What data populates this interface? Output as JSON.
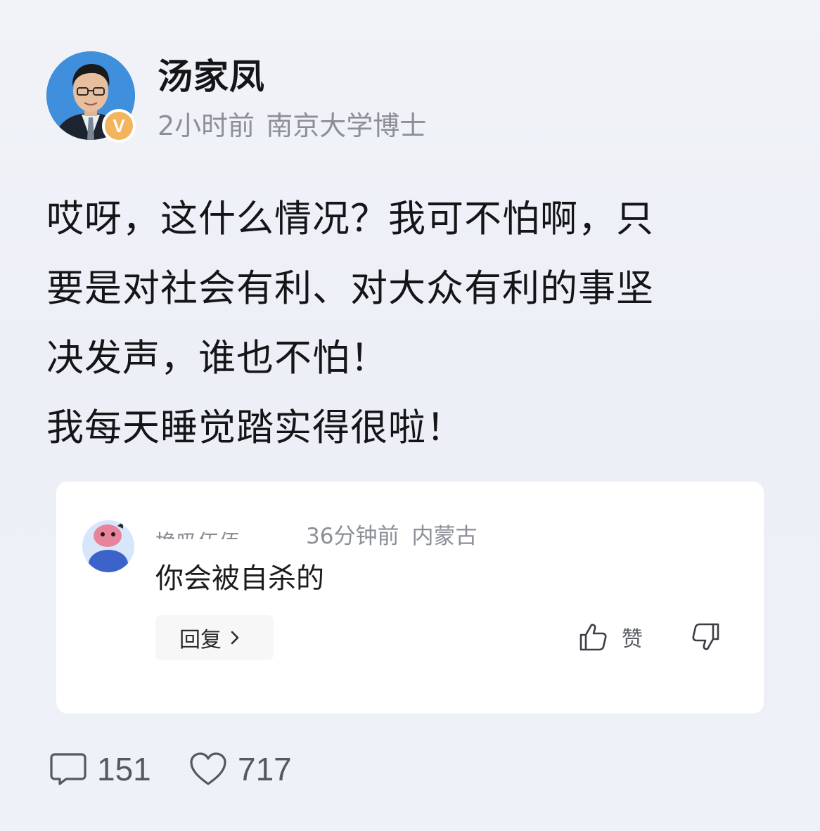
{
  "author": {
    "name": "汤家凤",
    "time": "2小时前",
    "title": "南京大学博士",
    "badge": "V"
  },
  "post": {
    "lines": [
      "哎呀，这什么情况？我可不怕啊，只",
      "要是对社会有利、对大众有利的事坚",
      "决发声，谁也不怕！",
      "我每天睡觉踏实得很啦！"
    ]
  },
  "comment": {
    "user": "换吸伍佰",
    "time": "36分钟前",
    "location": "内蒙古",
    "text": "你会被自杀的",
    "reply_label": "回复",
    "like_label": "赞"
  },
  "stats": {
    "comments": "151",
    "likes": "717"
  },
  "colors": {
    "verified_badge": "#f2b45c",
    "background": "#eef1f7"
  }
}
